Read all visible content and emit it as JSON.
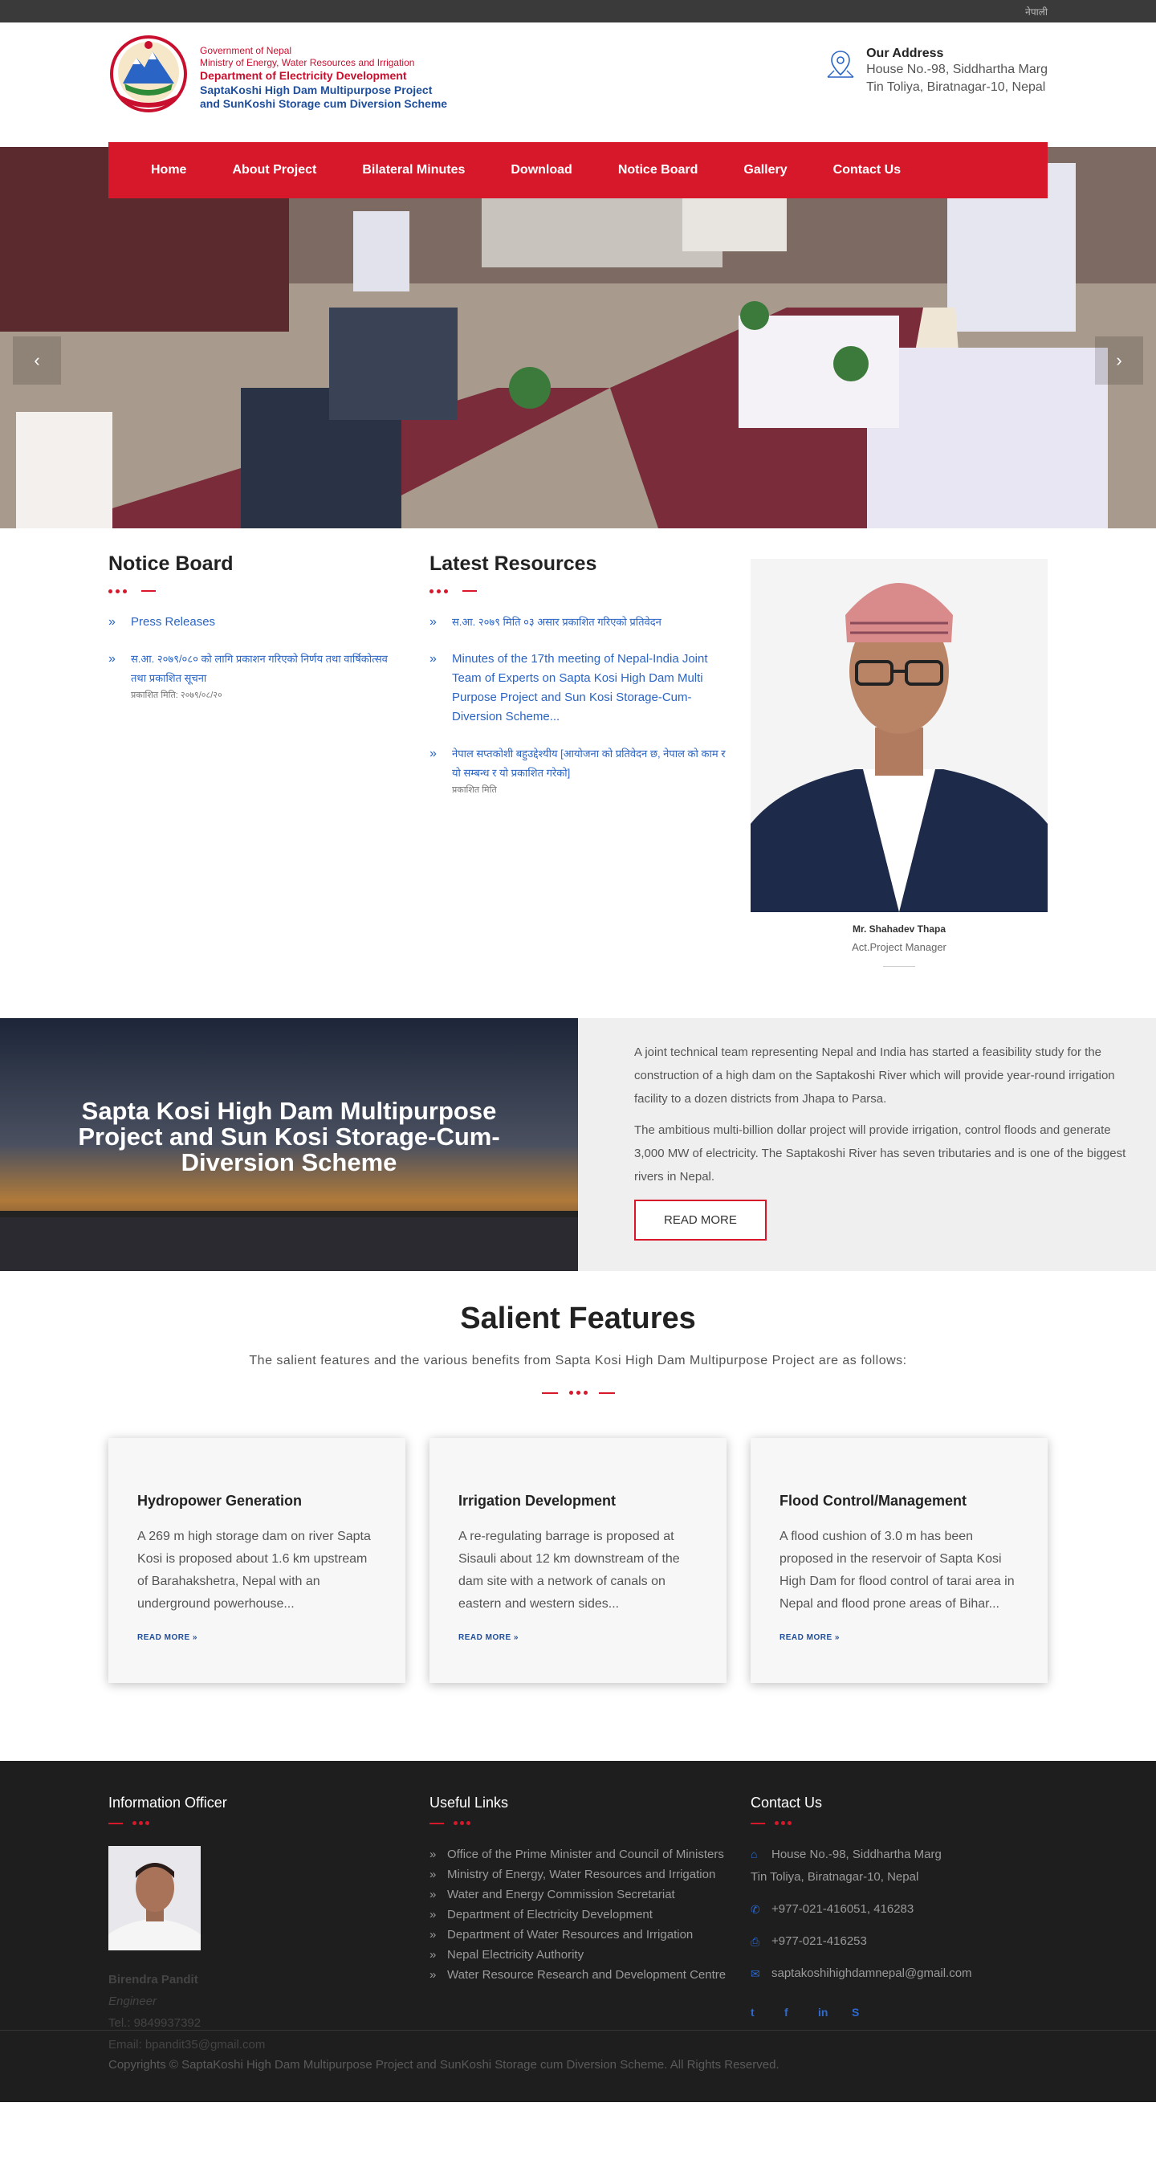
{
  "topbar": {
    "lang": "नेपाली"
  },
  "header": {
    "logo_lines": [
      "Government of Nepal",
      "Ministry of Energy, Water Resources and Irrigation",
      "Department of Electricity Development",
      "SaptaKoshi High Dam Multipurpose Project",
      "and SunKoshi Storage cum Diversion Scheme"
    ],
    "address_title": "Our Address",
    "address_line1": "House No.-98, Siddhartha Marg",
    "address_line2": "Tin Toliya, Biratnagar-10, Nepal"
  },
  "nav": [
    "Home",
    "About Project",
    "Bilateral Minutes",
    "Download",
    "Notice Board",
    "Gallery",
    "Contact Us"
  ],
  "hero": {
    "prev": "‹",
    "next": "›"
  },
  "notice_board": {
    "title": "Notice Board",
    "items": [
      {
        "text": "Press Releases",
        "date": ""
      },
      {
        "text": "स.आ. २०७९/०८० को लागि प्रकाशन गरिएको निर्णय तथा वार्षिकोत्सव तथा प्रकाशित सूचना",
        "date": "प्रकाशित मिति: २०७९/०८/२०"
      }
    ]
  },
  "resources": {
    "title": "Latest Resources",
    "items": [
      {
        "text": "स.आ. २०७९ मिति ०३ असार प्रकाशित गरिएको प्रतिवेदन",
        "date": ""
      },
      {
        "text": "Minutes of the 17th meeting of Nepal-India Joint Team of Experts on Sapta Kosi High Dam Multi Purpose Project and Sun Kosi Storage-Cum-Diversion Scheme...",
        "date": ""
      },
      {
        "text": "नेपाल सप्तकोशी बहुउद्देश्यीय [आयोजना को प्रतिवेदन छ, नेपाल को काम र यो सम्बन्ध र यो प्रकाशित गरेको]",
        "date": "प्रकाशित मिति"
      }
    ]
  },
  "manager": {
    "name": "Mr. Shahadev Thapa",
    "role": "Act.Project Manager"
  },
  "intro": {
    "heading": "Sapta Kosi High Dam Multipurpose Project and Sun Kosi Storage-Cum-Diversion Scheme",
    "p1": "A joint technical team representing Nepal and India has started a feasibility study for the construction of a high dam on the Saptakoshi River which will provide year-round irrigation facility to a dozen districts from Jhapa to Parsa.",
    "p2": "The ambitious multi-billion dollar project will provide irrigation, control floods and generate 3,000 MW of electricity. The Saptakoshi River has seven tributaries and is one of the biggest rivers in Nepal.",
    "button": "READ MORE"
  },
  "salient": {
    "title": "Salient Features",
    "subtitle": "The salient features and the various benefits from Sapta Kosi High Dam Multipurpose Project are as follows:",
    "cards": [
      {
        "title": "Hydropower Generation",
        "text": "A 269 m high storage dam on river Sapta Kosi is proposed about 1.6 km upstream of Barahakshetra, Nepal with an underground powerhouse...",
        "more": "READ MORE »"
      },
      {
        "title": "Irrigation Development",
        "text": "A re-regulating barrage is proposed at Sisauli about 12 km downstream of the dam site with a network of canals on eastern and western sides...",
        "more": "READ MORE »"
      },
      {
        "title": "Flood Control/Management",
        "text": "A flood cushion of 3.0 m has been proposed in the reservoir of Sapta Kosi High Dam for flood control of tarai area in Nepal and flood prone areas of Bihar...",
        "more": "READ MORE »"
      }
    ]
  },
  "footer": {
    "officer": {
      "title": "Information Officer",
      "name": "Birendra Pandit",
      "role": "Engineer",
      "tel": "Tel.: 9849937392",
      "email": "Email: bpandit35@gmail.com"
    },
    "links": {
      "title": "Useful Links",
      "items": [
        "Office of the Prime Minister and Council of Ministers",
        "Ministry of Energy, Water Resources and Irrigation",
        "Water and Energy Commission Secretariat",
        "Department of Electricity Development",
        "Department of Water Resources and Irrigation",
        "Nepal Electricity Authority",
        "Water Resource Research and Development Centre"
      ]
    },
    "contact": {
      "title": "Contact Us",
      "address1": "House No.-98, Siddhartha Marg",
      "address2": "Tin Toliya, Biratnagar-10, Nepal",
      "phone": "+977-021-416051, 416283",
      "fax": "+977-021-416253",
      "email": "saptakoshihighdamnepal@gmail.com"
    },
    "social": [
      "twitter-icon",
      "facebook-icon",
      "linkedin-icon",
      "skype-icon"
    ],
    "copyright": "Copyrights © SaptaKoshi High Dam Multipurpose Project and SunKoshi Storage cum Diversion Scheme. All Rights Reserved."
  }
}
